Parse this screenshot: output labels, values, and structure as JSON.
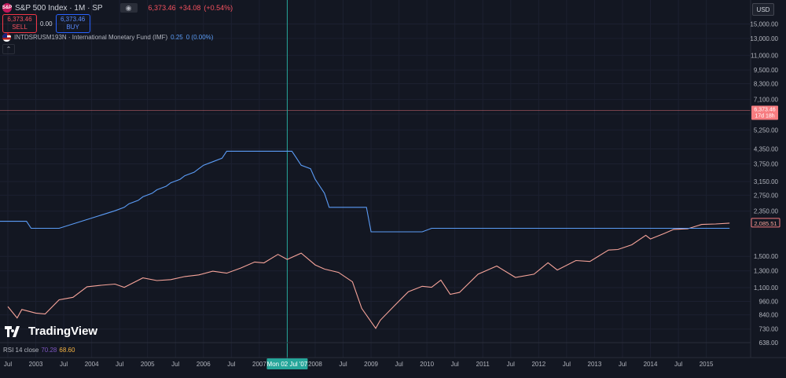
{
  "header": {
    "symbol_icon": "S&P",
    "title": "S&P 500 Index · 1M · SP",
    "price": "6,373.46",
    "change": "+34.08",
    "change_pct": "(+0.54%)",
    "sell_price": "6,373.46",
    "sell_label": "SELL",
    "spread": "0.00",
    "buy_price": "6,373.46",
    "buy_label": "BUY",
    "eye_icon": "eye-icon"
  },
  "overlay": {
    "name": "INTDSRUSM193N · International Monetary Fund (IMF)",
    "value": "0.25",
    "change": "0 (0.00%)",
    "flag_icon": "us-flag-icon"
  },
  "currency_button": "USD",
  "collapse_icon": "chevron-up-icon",
  "brand": {
    "name": "TradingView",
    "logo_icon": "tradingview-logo-icon"
  },
  "rsi": {
    "label": "RSI 14 close",
    "value1": "70.28",
    "value2": "68.60"
  },
  "crosshair_date": "Mon 02 Jul '07",
  "current_price_label": {
    "price": "6,373.46",
    "countdown": "17d 18h"
  },
  "last_value_label": "2,085.51",
  "colors": {
    "background": "#131722",
    "sp500_line": "#f7a49a",
    "rate_line": "#5b9cf6",
    "crosshair": "#26a69a",
    "price_label_bg": "#f77c80"
  },
  "chart_data": {
    "type": "line",
    "y_scale": "log",
    "ylim": [
      638,
      17600
    ],
    "y_ticks": [
      "15,000.00",
      "13,000.00",
      "11,000.00",
      "9,500.00",
      "8,300.00",
      "7,100.00",
      "6,150.00",
      "5,250.00",
      "4,350.00",
      "3,750.00",
      "3,150.00",
      "2,750.00",
      "2,350.00",
      "1,500.00",
      "1,300.00",
      "1,100.00",
      "960.00",
      "840.00",
      "730.00",
      "638.00"
    ],
    "x_ticks": [
      "Jul",
      "2003",
      "Jul",
      "2004",
      "Jul",
      "2005",
      "Jul",
      "2006",
      "Jul",
      "2007",
      "Jul",
      "2008",
      "Jul",
      "2009",
      "Jul",
      "2010",
      "Jul",
      "2011",
      "Jul",
      "2012",
      "Jul",
      "2013",
      "Jul",
      "2014",
      "Jul",
      "2015"
    ],
    "series": [
      {
        "name": "S&P 500 Index",
        "x": [
          "2002-07",
          "2002-09",
          "2002-10",
          "2003-01",
          "2003-03",
          "2003-06",
          "2003-09",
          "2003-12",
          "2004-03",
          "2004-06",
          "2004-08",
          "2004-12",
          "2005-03",
          "2005-06",
          "2005-09",
          "2005-12",
          "2006-03",
          "2006-06",
          "2006-09",
          "2006-12",
          "2007-02",
          "2007-05",
          "2007-07",
          "2007-10",
          "2008-01",
          "2008-03",
          "2008-06",
          "2008-09",
          "2008-11",
          "2009-02",
          "2009-03",
          "2009-06",
          "2009-09",
          "2009-12",
          "2010-02",
          "2010-04",
          "2010-06",
          "2010-08",
          "2010-12",
          "2011-04",
          "2011-08",
          "2011-12",
          "2012-03",
          "2012-05",
          "2012-09",
          "2012-12",
          "2013-04",
          "2013-06",
          "2013-09",
          "2013-12",
          "2014-01",
          "2014-04",
          "2014-06",
          "2014-09",
          "2014-12",
          "2015-03",
          "2015-06"
        ],
        "values": [
          912,
          815,
          886,
          855,
          848,
          975,
          1000,
          1110,
          1126,
          1140,
          1104,
          1212,
          1180,
          1191,
          1228,
          1248,
          1295,
          1270,
          1336,
          1418,
          1406,
          1530,
          1455,
          1549,
          1378,
          1322,
          1280,
          1166,
          896,
          735,
          797,
          919,
          1057,
          1115,
          1104,
          1186,
          1030,
          1049,
          1257,
          1363,
          1218,
          1257,
          1408,
          1310,
          1440,
          1426,
          1597,
          1606,
          1682,
          1848,
          1782,
          1883,
          1960,
          1972,
          2058,
          2067,
          2085
        ]
      },
      {
        "name": "INTDSRUSM193N",
        "x": [
          "2002-07",
          "2002-11",
          "2002-12",
          "2003-06",
          "2004-06",
          "2004-08",
          "2004-09",
          "2004-11",
          "2004-12",
          "2005-02",
          "2005-03",
          "2005-05",
          "2005-06",
          "2005-08",
          "2005-09",
          "2005-11",
          "2005-12",
          "2006-01",
          "2006-03",
          "2006-05",
          "2006-06",
          "2007-08",
          "2007-09",
          "2007-10",
          "2007-12",
          "2008-01",
          "2008-02",
          "2008-03",
          "2008-04",
          "2008-12",
          "2009-01",
          "2009-12",
          "2010-02",
          "2015-06"
        ],
        "values": [
          1.25,
          1.25,
          0.75,
          0.75,
          2.0,
          2.25,
          2.5,
          2.75,
          3.0,
          3.25,
          3.5,
          3.75,
          4.0,
          4.25,
          4.5,
          4.75,
          5.0,
          5.25,
          5.5,
          5.75,
          6.25,
          6.25,
          5.75,
          5.25,
          5.0,
          4.25,
          3.75,
          3.25,
          2.25,
          2.25,
          0.5,
          0.5,
          0.75,
          0.75
        ]
      }
    ]
  }
}
